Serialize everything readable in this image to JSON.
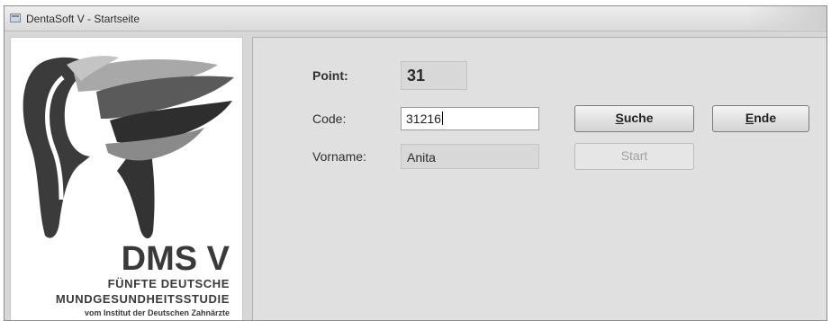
{
  "window": {
    "title": "DentaSoft V - Startseite"
  },
  "logo": {
    "title": "DMS V",
    "subtitle_line1": "FÜNFTE DEUTSCHE",
    "subtitle_line2": "MUNDGESUNDHEITSSTUDIE",
    "subtitle_line3": "vom Institut der Deutschen Zahnärzte"
  },
  "form": {
    "point_label": "Point:",
    "point_value": "31",
    "code_label": "Code:",
    "code_value": "31216",
    "vorname_label": "Vorname:",
    "vorname_value": "Anita"
  },
  "buttons": {
    "suche_label": "Suche",
    "ende_label": "Ende",
    "start_label": "Start"
  },
  "colors": {
    "window_bg": "#d7d7d7",
    "panel_bg": "#e0e0e0",
    "disabled_text": "#a2a2a2"
  }
}
